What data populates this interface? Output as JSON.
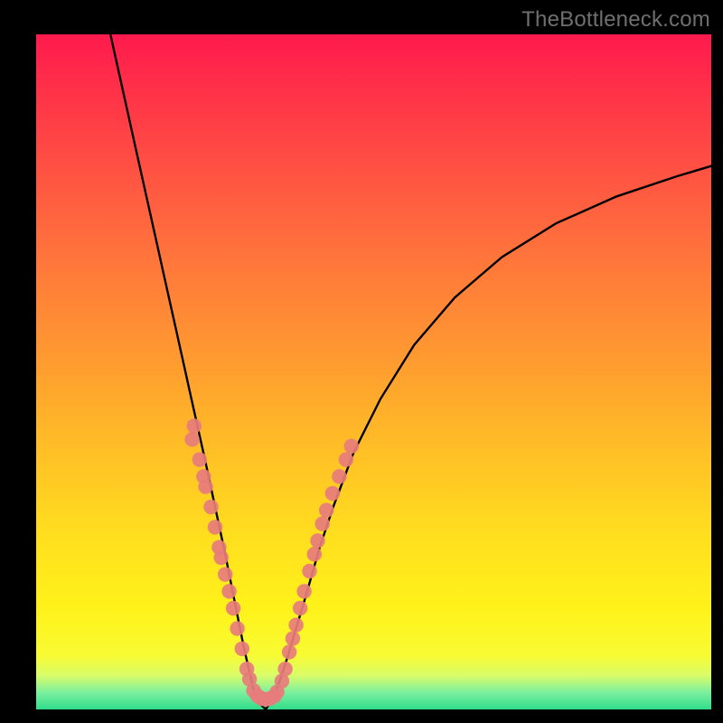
{
  "watermark": "TheBottleneck.com",
  "chart_data": {
    "type": "line",
    "title": "",
    "xlabel": "",
    "ylabel": "",
    "xlim": [
      0,
      100
    ],
    "ylim": [
      0,
      100
    ],
    "grid": false,
    "series": [
      {
        "name": "left-curve",
        "x": [
          11,
          13,
          15,
          17,
          19,
          21,
          23,
          25,
          26.5,
          28,
          29,
          30,
          30.8,
          31.5,
          32.2,
          33,
          34
        ],
        "y": [
          100,
          91,
          82,
          73,
          64,
          55,
          46,
          37,
          30,
          23,
          18,
          13,
          9,
          6,
          3,
          1,
          0
        ]
      },
      {
        "name": "right-curve",
        "x": [
          34,
          35,
          36,
          37,
          38.5,
          40,
          42,
          44,
          47,
          51,
          56,
          62,
          69,
          77,
          86,
          95,
          100
        ],
        "y": [
          0,
          1.5,
          4,
          7,
          12,
          17,
          24,
          30,
          38,
          46,
          54,
          61,
          67,
          72,
          76,
          79,
          80.5
        ]
      }
    ],
    "markers": {
      "name": "datapoints",
      "color": "#e77c7c",
      "radius_approx": 1.1,
      "points": [
        {
          "x": 23.4,
          "y": 42
        },
        {
          "x": 23.1,
          "y": 40
        },
        {
          "x": 24.2,
          "y": 37
        },
        {
          "x": 24.8,
          "y": 34.5
        },
        {
          "x": 25.1,
          "y": 33
        },
        {
          "x": 25.9,
          "y": 30
        },
        {
          "x": 26.5,
          "y": 27
        },
        {
          "x": 27.1,
          "y": 24
        },
        {
          "x": 27.4,
          "y": 22.5
        },
        {
          "x": 28.0,
          "y": 20
        },
        {
          "x": 28.6,
          "y": 17.5
        },
        {
          "x": 29.2,
          "y": 15
        },
        {
          "x": 29.8,
          "y": 12
        },
        {
          "x": 30.5,
          "y": 9
        },
        {
          "x": 31.2,
          "y": 6
        },
        {
          "x": 31.6,
          "y": 4.5
        },
        {
          "x": 32.2,
          "y": 2.8
        },
        {
          "x": 32.8,
          "y": 2.0
        },
        {
          "x": 33.4,
          "y": 1.6
        },
        {
          "x": 34.0,
          "y": 1.5
        },
        {
          "x": 34.6,
          "y": 1.6
        },
        {
          "x": 35.3,
          "y": 2.0
        },
        {
          "x": 35.7,
          "y": 2.6
        },
        {
          "x": 36.4,
          "y": 4.2
        },
        {
          "x": 36.9,
          "y": 6.0
        },
        {
          "x": 37.5,
          "y": 8.5
        },
        {
          "x": 38.0,
          "y": 10.5
        },
        {
          "x": 38.5,
          "y": 12.5
        },
        {
          "x": 39.1,
          "y": 15
        },
        {
          "x": 39.7,
          "y": 17.5
        },
        {
          "x": 40.5,
          "y": 20.5
        },
        {
          "x": 41.2,
          "y": 23
        },
        {
          "x": 41.7,
          "y": 25
        },
        {
          "x": 42.4,
          "y": 27.5
        },
        {
          "x": 43.0,
          "y": 29.5
        },
        {
          "x": 43.9,
          "y": 32
        },
        {
          "x": 44.9,
          "y": 34.5
        },
        {
          "x": 45.9,
          "y": 37
        },
        {
          "x": 46.7,
          "y": 39
        }
      ]
    }
  }
}
